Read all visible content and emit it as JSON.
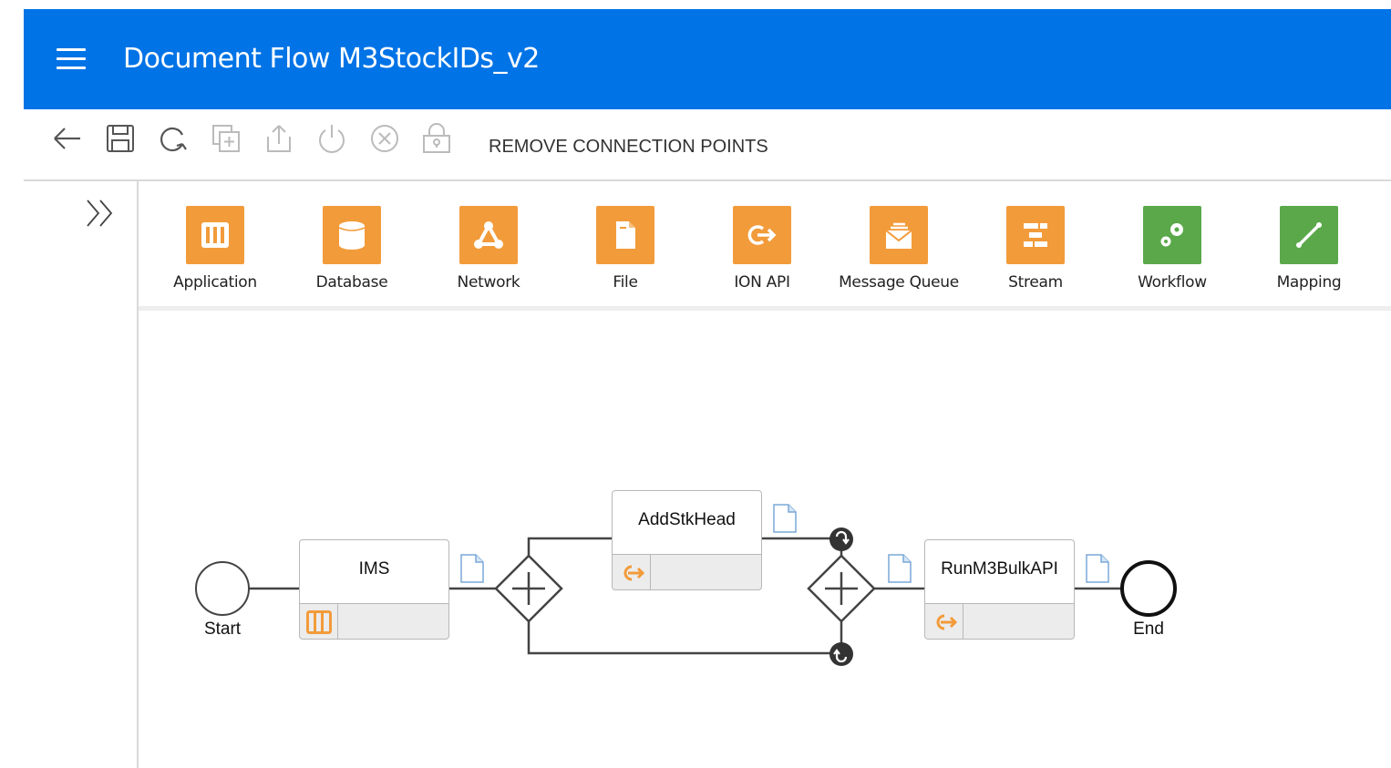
{
  "header": {
    "title": "Document Flow M3StockIDs_v2",
    "background": "#0073e6"
  },
  "toolbar": {
    "icons": [
      "back-arrow-icon",
      "save-icon",
      "refresh-icon",
      "copy-icon",
      "export-icon",
      "power-icon",
      "cancel-icon",
      "lock-icon"
    ],
    "remove_connection_points": "REMOVE CONNECTION POINTS"
  },
  "sidebar": {
    "expand_icon": "chevron-double-right-icon"
  },
  "palette": {
    "items": [
      {
        "label": "Application",
        "icon": "application-icon",
        "color": "#f29b3a"
      },
      {
        "label": "Database",
        "icon": "database-icon",
        "color": "#f29b3a"
      },
      {
        "label": "Network",
        "icon": "network-icon",
        "color": "#f29b3a"
      },
      {
        "label": "File",
        "icon": "file-icon",
        "color": "#f29b3a"
      },
      {
        "label": "ION API",
        "icon": "ion-api-icon",
        "color": "#f29b3a"
      },
      {
        "label": "Message Queue",
        "icon": "message-queue-icon",
        "color": "#f29b3a"
      },
      {
        "label": "Stream",
        "icon": "stream-icon",
        "color": "#f29b3a"
      },
      {
        "label": "Workflow",
        "icon": "workflow-icon",
        "color": "#5aa84a"
      },
      {
        "label": "Mapping",
        "icon": "mapping-icon",
        "color": "#5aa84a"
      }
    ]
  },
  "flow": {
    "start_label": "Start",
    "end_label": "End",
    "tasks": [
      {
        "label": "IMS",
        "type_icon": "application-icon"
      },
      {
        "label": "AddStkHead",
        "type_icon": "ion-api-icon"
      },
      {
        "label": "RunM3BulkAPI",
        "type_icon": "ion-api-icon"
      }
    ],
    "accent": "#f29b3a"
  }
}
